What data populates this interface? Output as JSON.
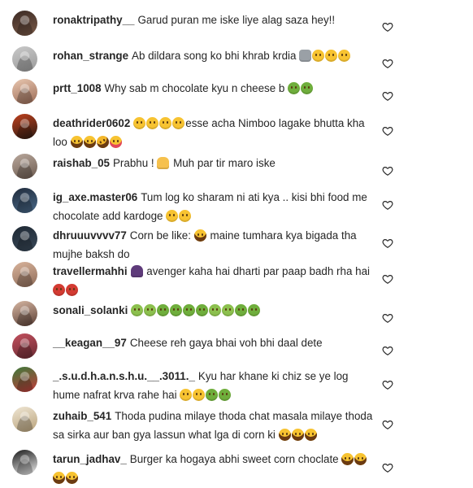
{
  "comments": [
    {
      "username": "ronaktripathy__",
      "text": "Garud puran me iske liye alag saza hey!!",
      "emojis": [],
      "avatar_colors": [
        "#3b2a24",
        "#7a5a48"
      ]
    },
    {
      "username": "rohan_strange",
      "text": "Ab dildara song ko bhi khrab krdia",
      "emojis": [
        "moai",
        "neutral",
        "neutral",
        "neutral"
      ],
      "avatar_colors": [
        "#c9c9c9",
        "#9a9a9a"
      ]
    },
    {
      "username": "prtt_1008",
      "text": "Why sab m chocolate kyu n cheese b",
      "emojis": [
        "nauseated",
        "nauseated"
      ],
      "avatar_colors": [
        "#e9c7b0",
        "#9a6a55"
      ]
    },
    {
      "username": "deathrider0602",
      "text": "esse acha Nimboo lagake bhutta kha loo",
      "emojis_before": [
        "neutral",
        "neutral",
        "neutral",
        "neutral"
      ],
      "emojis": [
        "joy",
        "joy",
        "rofl",
        "yum"
      ],
      "avatar_colors": [
        "#c0411e",
        "#2a1a12"
      ]
    },
    {
      "username": "raishab_05",
      "text": "Prabhu !",
      "text_after": "Muh par tir maro iske",
      "emojis_mid": [
        "pray"
      ],
      "emojis": [],
      "avatar_colors": [
        "#b9a89c",
        "#6c5a4f"
      ]
    },
    {
      "username": "ig_axe.master06",
      "text": "Tum log ko sharam ni ati kya .. kisi bhi food me chocolate add kardoge",
      "emojis": [
        "woozy",
        "woozy"
      ],
      "avatar_colors": [
        "#1f2a3a",
        "#4a6a8a"
      ]
    },
    {
      "username": "dhruuuvvvv77",
      "text": "Corn be like:",
      "text_after": "maine tumhara kya bigada tha mujhe baksh do",
      "emojis_mid": [
        "joy"
      ],
      "emojis": [],
      "avatar_colors": [
        "#1e2833",
        "#3a4a5a"
      ]
    },
    {
      "username": "travellermahhi",
      "text": "",
      "text_after": "avenger kaha hai dharti par paap badh rha hai",
      "emojis_mid": [
        "facepalm"
      ],
      "emojis": [
        "angry",
        "angry"
      ],
      "avatar_colors": [
        "#d9b49c",
        "#8e6b58"
      ]
    },
    {
      "username": "sonali_solanki",
      "text": "",
      "emojis": [
        "sick",
        "sick",
        "nauseated",
        "nauseated",
        "nauseated",
        "nauseated",
        "sick",
        "sick",
        "nauseated",
        "nauseated"
      ],
      "avatar_colors": [
        "#d7b7a3",
        "#5b3f35"
      ]
    },
    {
      "username": "__keagan__97",
      "text": "Cheese reh gaya bhai voh bhi daal dete",
      "emojis": [],
      "avatar_colors": [
        "#c3505e",
        "#6a2b33"
      ]
    },
    {
      "username": "_.s.u.d.h.a.n.s.h.u.__.3011._",
      "text": "Kyu har khane ki chiz se ye log hume nafrat krva rahe hai",
      "emojis": [
        "neutral",
        "neutral",
        "nauseated",
        "nauseated"
      ],
      "avatar_colors": [
        "#3c7a3a",
        "#c43b3b"
      ]
    },
    {
      "username": "zuhaib_541",
      "text": "Thoda pudina milaye thoda chat masala milaye thoda sa sirka aur ban gya lassun what lga di corn ki",
      "emojis": [
        "joy",
        "joy",
        "joy"
      ],
      "avatar_colors": [
        "#efe6d4",
        "#b9a27a"
      ]
    },
    {
      "username": "tarun_jadhav_",
      "text": "Burger ka hogaya abhi sweet corn choclate",
      "emojis": [
        "joy",
        "joy",
        "joy",
        "joy"
      ],
      "avatar_colors": [
        "#1a1a1a",
        "#f0f0f0"
      ]
    }
  ]
}
